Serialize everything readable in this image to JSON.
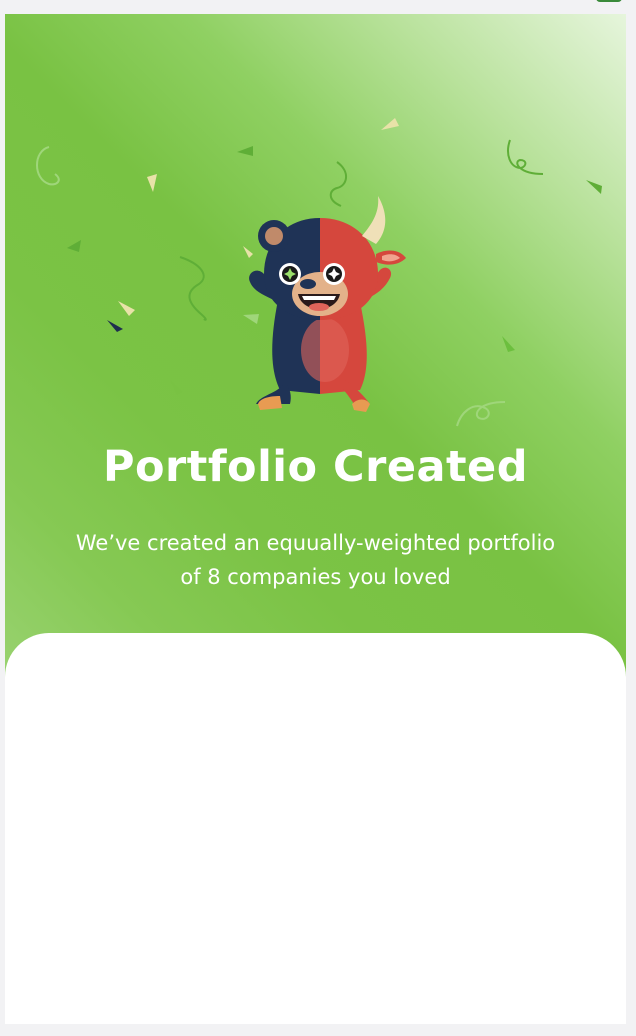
{
  "hero": {
    "title": "Portfolio Created",
    "subtitle": "We’ve created an equually-weighted portfolio of 8 companies you loved",
    "gradient_colors": [
      "#e6f5dc",
      "#b9e29c",
      "#79c243",
      "#9ad372"
    ],
    "illustration": "celebrating-bull-bear-mascot"
  },
  "colors": {
    "background": "#f2f2f4",
    "hero_green": "#79c243",
    "confetti_green": "#6cbf3e",
    "confetti_cream": "#e8e2a8",
    "confetti_navy": "#1f2f4e",
    "sheet_white": "#ffffff"
  }
}
